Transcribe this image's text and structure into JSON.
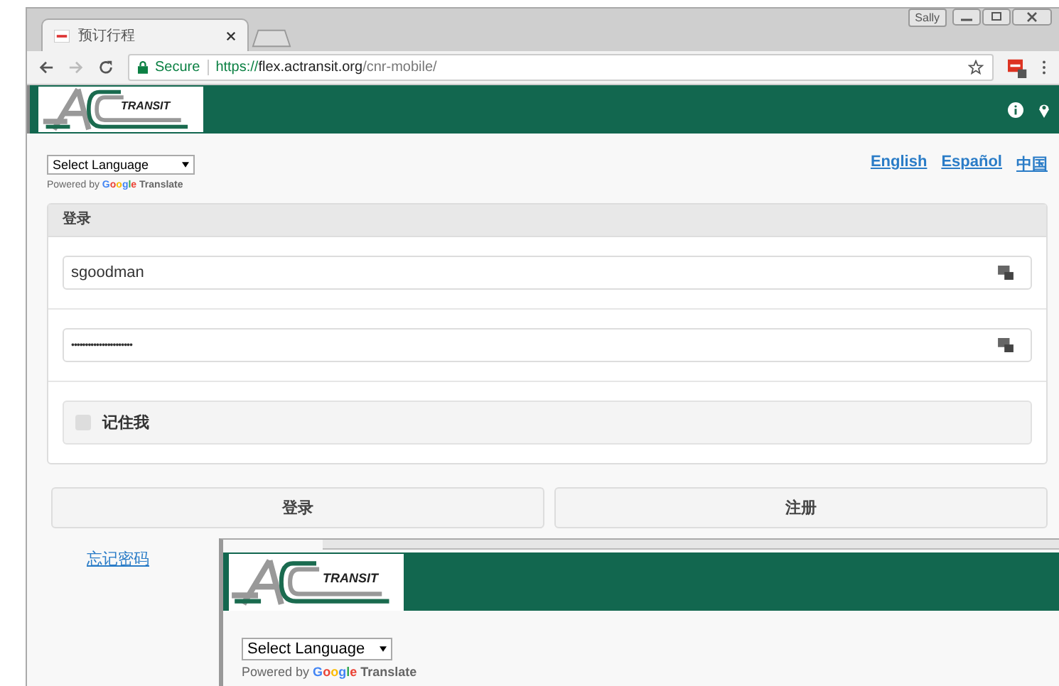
{
  "browser": {
    "profile": "Sally",
    "tab": {
      "title": "预订行程"
    },
    "address": {
      "secure_label": "Secure",
      "scheme": "https://",
      "host": "flex.actransit.org",
      "path": "/cnr-mobile/"
    }
  },
  "header": {
    "logo_text": "TRANSIT"
  },
  "translate": {
    "select": "Select Language",
    "powered_by": "Powered by",
    "brand": "Google",
    "product": "Translate"
  },
  "languages": [
    {
      "label": "English"
    },
    {
      "label": "Español"
    },
    {
      "label": "中国"
    }
  ],
  "login": {
    "title": "登录",
    "username": "sgoodman",
    "password": "••••••••••••••••••••••",
    "remember": {
      "label": "记住我",
      "checked": false
    }
  },
  "buttons": [
    "登录",
    "注册"
  ],
  "forgot_link": "忘记密码",
  "overlay": {
    "logo_text": "TRANSIT",
    "translate": {
      "select": "Select Language",
      "powered_by": "Powered by",
      "brand": "Google",
      "product": "Translate"
    }
  }
}
